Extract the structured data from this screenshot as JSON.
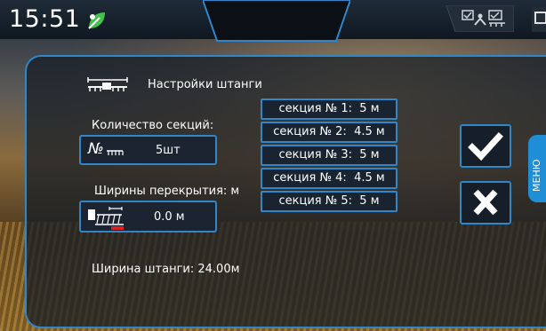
{
  "status_bar": {
    "time": "15:51"
  },
  "settings": {
    "title": "Настройки штанги",
    "sections_count_label": "Количество секций:",
    "sections_count_prefix": "№",
    "sections_count_value": "5шт",
    "overlap_label": "Ширины перекрытия: м",
    "overlap_value": "0.0 м",
    "boom_width_label": "Ширина штанги: 24.00м",
    "sections": [
      {
        "label": "секция № 1:",
        "value": "5 м"
      },
      {
        "label": "секция № 2:",
        "value": "4.5 м"
      },
      {
        "label": "секция № 3:",
        "value": "5 м"
      },
      {
        "label": "секция № 4:",
        "value": "4.5 м"
      },
      {
        "label": "секция № 5:",
        "value": "5 м"
      }
    ]
  },
  "menu_tab": {
    "label": "МЕНЮ"
  },
  "colors": {
    "accent": "#2f86c9",
    "menu_tab": "#1f8ed6",
    "leaf_green": "#3fc34a"
  },
  "icons": [
    "leaf-icon",
    "boom-sprayer-icon",
    "section-count-icon",
    "overlap-sprayer-icon",
    "checkmark-icon",
    "close-icon",
    "status-icons"
  ]
}
